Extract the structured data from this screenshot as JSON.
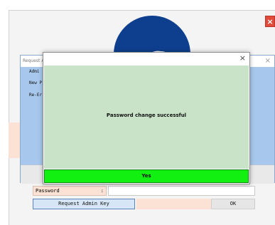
{
  "app": {
    "close_glyph": "×"
  },
  "request_dialog": {
    "title": "Request A",
    "close_glyph": "×",
    "labels": [
      "Admi",
      "New P",
      "Re-Er"
    ]
  },
  "password_row": {
    "label": "Password",
    "colon": ":"
  },
  "buttons": {
    "request_admin_key": "Request Admin Key",
    "ok": "OK"
  },
  "modal": {
    "close_glyph": "×",
    "message": "Password change successful",
    "yes_label": "Yes"
  },
  "colors": {
    "modal_body": "#c8e3c8",
    "yes_button": "#11f011",
    "request_dialog": "#a7c8ec",
    "peach": "#fbe2d4",
    "logo_blue": "#0e3f8f",
    "close_red": "#e24b3c"
  },
  "icons": {
    "logo": "lion-logo-icon"
  }
}
